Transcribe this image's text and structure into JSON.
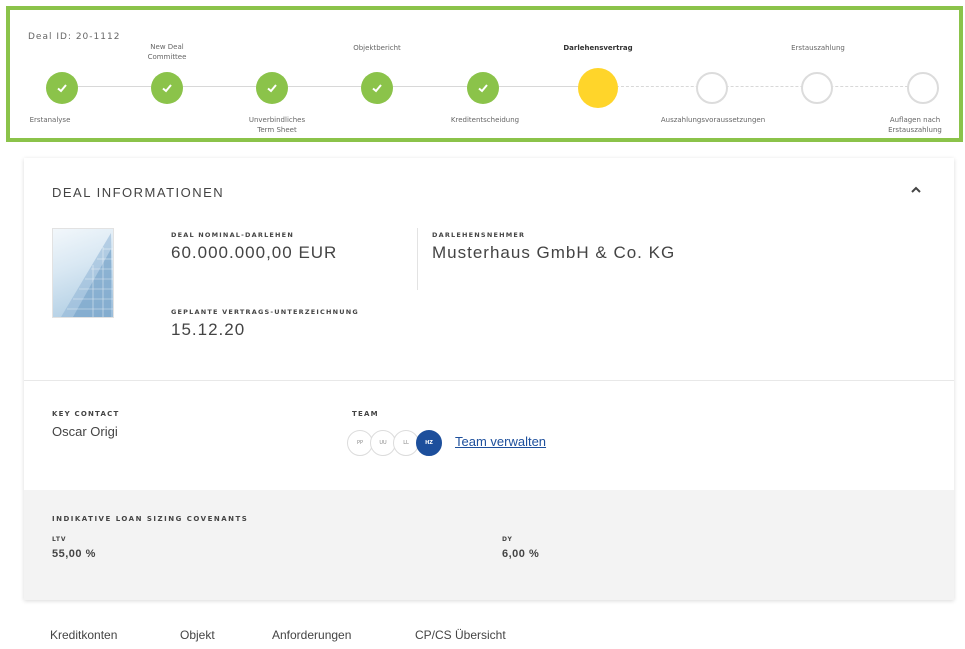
{
  "stepper": {
    "deal_id": "Deal ID: 20-1112",
    "steps": [
      {
        "label": "Erstanalyse",
        "state": "done"
      },
      {
        "label": "New Deal Committee",
        "state": "done"
      },
      {
        "label": "Unverbindliches Term Sheet",
        "state": "done"
      },
      {
        "label": "Objektbericht",
        "state": "done"
      },
      {
        "label": "Kreditentscheidung",
        "state": "done"
      },
      {
        "label": "Darlehensvertrag",
        "state": "current"
      },
      {
        "label": "Auszahlungsvoraussetzungen",
        "state": "todo"
      },
      {
        "label": "Erstauszahlung",
        "state": "todo"
      },
      {
        "label": "Auflagen nach Erstauszahlung",
        "state": "todo"
      }
    ],
    "colors": {
      "done": "#8bc34a",
      "current": "#ffd52a",
      "todo": "#ffffff",
      "border": "#8bc34a"
    }
  },
  "deal": {
    "title": "DEAL INFORMATIONEN",
    "nominal_label": "DEAL NOMINAL-DARLEHEN",
    "nominal_value": "60.000.000,00 EUR",
    "borrower_label": "DARLEHENSNEHMER",
    "borrower_value": "Musterhaus GmbH & Co. KG",
    "signing_label": "GEPLANTE VERTRAGS-UNTERZEICHNUNG",
    "signing_value": "15.12.20"
  },
  "contact": {
    "key_contact_label": "KEY CONTACT",
    "key_contact_value": "Oscar Origi",
    "team_label": "TEAM",
    "team_members": [
      "PP",
      "UU",
      "LL",
      "HZ"
    ],
    "team_link": "Team verwalten"
  },
  "covenants": {
    "title": "INDIKATIVE LOAN SIZING COVENANTS",
    "ltv_label": "LTV",
    "ltv_value": "55,00 %",
    "dy_label": "DY",
    "dy_value": "6,00 %"
  },
  "tabs": [
    "Kreditkonten",
    "Objekt",
    "Anforderungen",
    "CP/CS Übersicht"
  ],
  "accent": "#1d4f9c"
}
